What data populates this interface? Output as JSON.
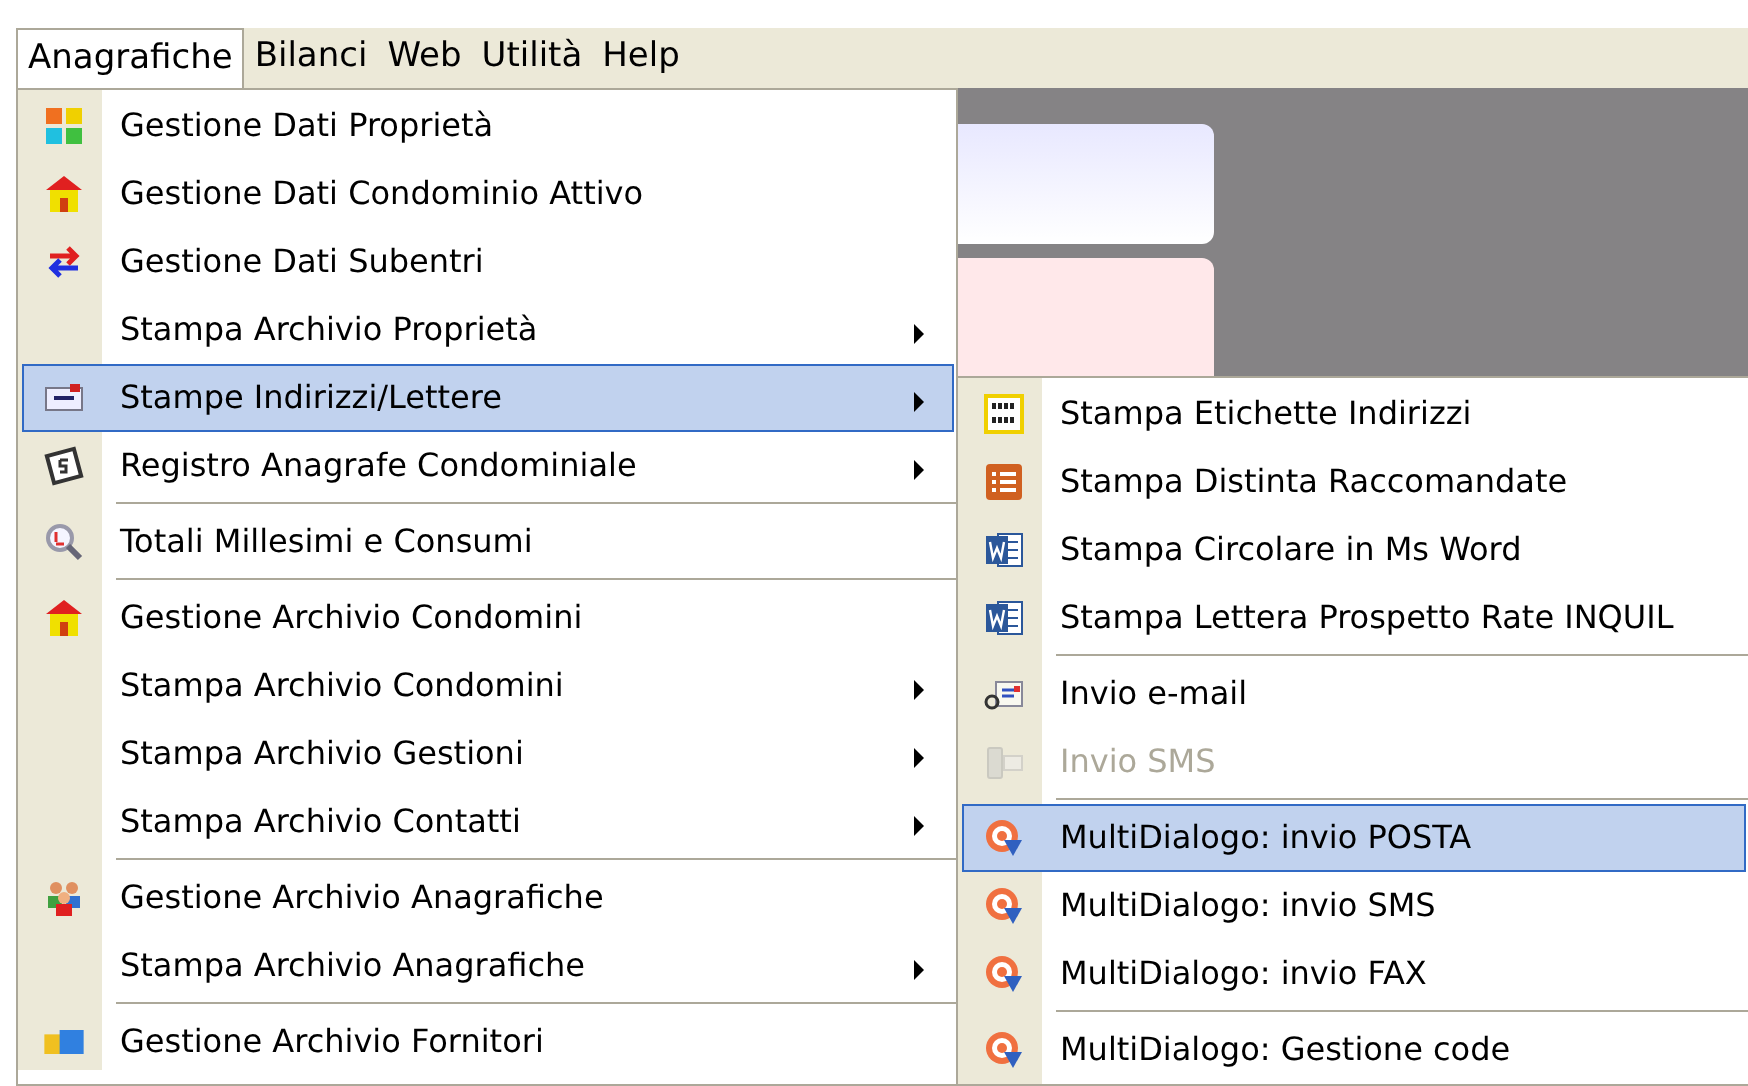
{
  "menubar": [
    {
      "label": "Anagrafiche",
      "selected": true
    },
    {
      "label": "Bilanci",
      "selected": false
    },
    {
      "label": "Web",
      "selected": false
    },
    {
      "label": "Utilità",
      "selected": false
    },
    {
      "label": "Help",
      "selected": false
    }
  ],
  "menu": [
    {
      "kind": "item",
      "label": "Gestione Dati Proprietà",
      "submenu": false,
      "selected": false
    },
    {
      "kind": "item",
      "label": "Gestione Dati Condominio Attivo",
      "submenu": false,
      "selected": false
    },
    {
      "kind": "item",
      "label": "Gestione Dati Subentri",
      "submenu": false,
      "selected": false
    },
    {
      "kind": "item",
      "label": "Stampa Archivio Proprietà",
      "submenu": true,
      "selected": false
    },
    {
      "kind": "item",
      "label": "Stampe Indirizzi/Lettere",
      "submenu": true,
      "selected": true
    },
    {
      "kind": "item",
      "label": "Registro Anagrafe Condominiale",
      "submenu": true,
      "selected": false
    },
    {
      "kind": "separator"
    },
    {
      "kind": "item",
      "label": "Totali Millesimi e Consumi",
      "submenu": false,
      "selected": false
    },
    {
      "kind": "separator"
    },
    {
      "kind": "item",
      "label": "Gestione Archivio Condomini",
      "submenu": false,
      "selected": false
    },
    {
      "kind": "item",
      "label": "Stampa Archivio Condomini",
      "submenu": true,
      "selected": false
    },
    {
      "kind": "item",
      "label": "Stampa Archivio Gestioni",
      "submenu": true,
      "selected": false
    },
    {
      "kind": "item",
      "label": "Stampa Archivio Contatti",
      "submenu": true,
      "selected": false
    },
    {
      "kind": "separator"
    },
    {
      "kind": "item",
      "label": "Gestione Archivio Anagrafiche",
      "submenu": false,
      "selected": false
    },
    {
      "kind": "item",
      "label": "Stampa Archivio Anagrafiche",
      "submenu": true,
      "selected": false
    },
    {
      "kind": "separator"
    },
    {
      "kind": "item",
      "label": "Gestione Archivio Fornitori",
      "submenu": false,
      "selected": false
    }
  ],
  "submenu": [
    {
      "kind": "item",
      "label": "Stampa Etichette Indirizzi",
      "selected": false,
      "disabled": false
    },
    {
      "kind": "item",
      "label": "Stampa Distinta Raccomandate",
      "selected": false,
      "disabled": false
    },
    {
      "kind": "item",
      "label": "Stampa Circolare in Ms Word",
      "selected": false,
      "disabled": false
    },
    {
      "kind": "item",
      "label": "Stampa Lettera Prospetto Rate INQUIL",
      "selected": false,
      "disabled": false
    },
    {
      "kind": "separator"
    },
    {
      "kind": "item",
      "label": "Invio e-mail",
      "selected": false,
      "disabled": false
    },
    {
      "kind": "item",
      "label": "Invio SMS",
      "selected": false,
      "disabled": true
    },
    {
      "kind": "separator"
    },
    {
      "kind": "item",
      "label": "MultiDialogo: invio POSTA",
      "selected": true,
      "disabled": false
    },
    {
      "kind": "item",
      "label": "MultiDialogo: invio SMS",
      "selected": false,
      "disabled": false
    },
    {
      "kind": "item",
      "label": "MultiDialogo: invio FAX",
      "selected": false,
      "disabled": false
    },
    {
      "kind": "separator"
    },
    {
      "kind": "item",
      "label": "MultiDialogo: Gestione code",
      "selected": false,
      "disabled": false
    }
  ]
}
